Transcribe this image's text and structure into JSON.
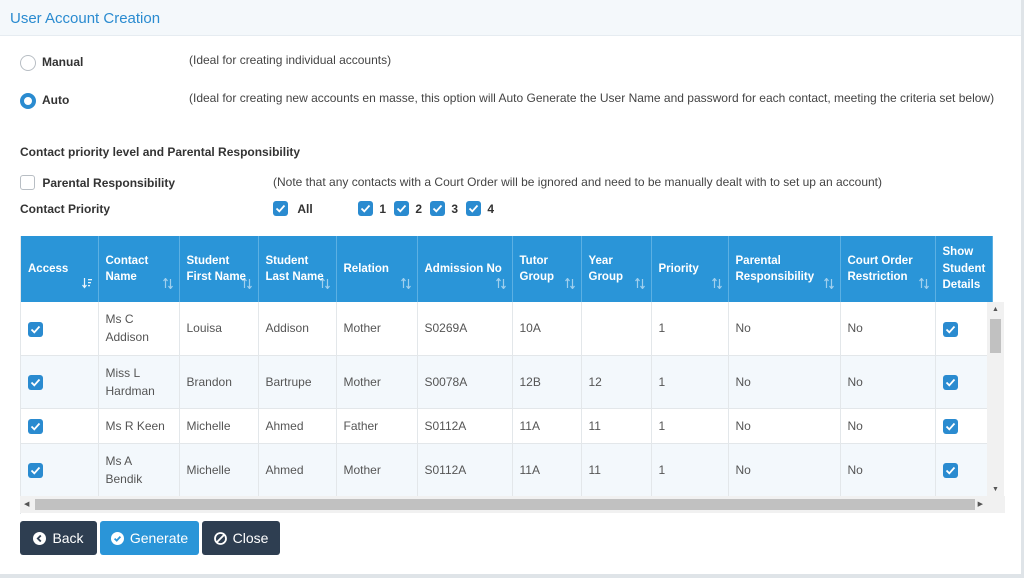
{
  "dialog": {
    "title": "User Account Creation"
  },
  "mode": {
    "options": [
      {
        "label": "Manual",
        "description": "(Ideal for creating individual accounts)",
        "checked": false
      },
      {
        "label": "Auto",
        "description": "(Ideal for creating new accounts en masse, this option will Auto Generate the User Name and password for each contact, meeting the criteria set below)",
        "checked": true
      }
    ]
  },
  "contact": {
    "section_title": "Contact priority level and Parental Responsibility",
    "parental_label": "Parental Responsibility",
    "parental_checked": false,
    "court_note": "(Note that any contacts with a Court Order will be ignored and need to be manually dealt with to set up an account)",
    "priority_label": "Contact Priority",
    "priority_options": [
      {
        "label": "All",
        "checked": true
      },
      {
        "label": "1",
        "checked": true
      },
      {
        "label": "2",
        "checked": true
      },
      {
        "label": "3",
        "checked": true
      },
      {
        "label": "4",
        "checked": true
      }
    ]
  },
  "table": {
    "columns": [
      "Access",
      "Contact Name",
      "Student First Name",
      "Student Last Name",
      "Relation",
      "Admission No",
      "Tutor Group",
      "Year Group",
      "Priority",
      "Parental Responsibility",
      "Court Order Restriction",
      "Show Student Details"
    ],
    "rows": [
      {
        "access": true,
        "contact_name": "Ms C Addison",
        "first_name": "Louisa",
        "last_name": "Addison",
        "relation": "Mother",
        "admission_no": "S0269A",
        "tutor_group": "10A",
        "year_group": "",
        "priority": "1",
        "parental": "No",
        "court_order": "No",
        "show_details": true
      },
      {
        "access": true,
        "contact_name": "Miss L Hardman",
        "first_name": "Brandon",
        "last_name": "Bartrupe",
        "relation": "Mother",
        "admission_no": "S0078A",
        "tutor_group": "12B",
        "year_group": "12",
        "priority": "1",
        "parental": "No",
        "court_order": "No",
        "show_details": true
      },
      {
        "access": true,
        "contact_name": "Ms R Keen",
        "first_name": "Michelle",
        "last_name": "Ahmed",
        "relation": "Father",
        "admission_no": "S0112A",
        "tutor_group": "11A",
        "year_group": "11",
        "priority": "1",
        "parental": "No",
        "court_order": "No",
        "show_details": true
      },
      {
        "access": true,
        "contact_name": "Ms A Bendik",
        "first_name": "Michelle",
        "last_name": "Ahmed",
        "relation": "Mother",
        "admission_no": "S0112A",
        "tutor_group": "11A",
        "year_group": "11",
        "priority": "1",
        "parental": "No",
        "court_order": "No",
        "show_details": true
      }
    ]
  },
  "buttons": {
    "back": "Back",
    "generate": "Generate",
    "close": "Close"
  },
  "colors": {
    "accent": "#2a95d8",
    "dark_button": "#2e3e51"
  }
}
